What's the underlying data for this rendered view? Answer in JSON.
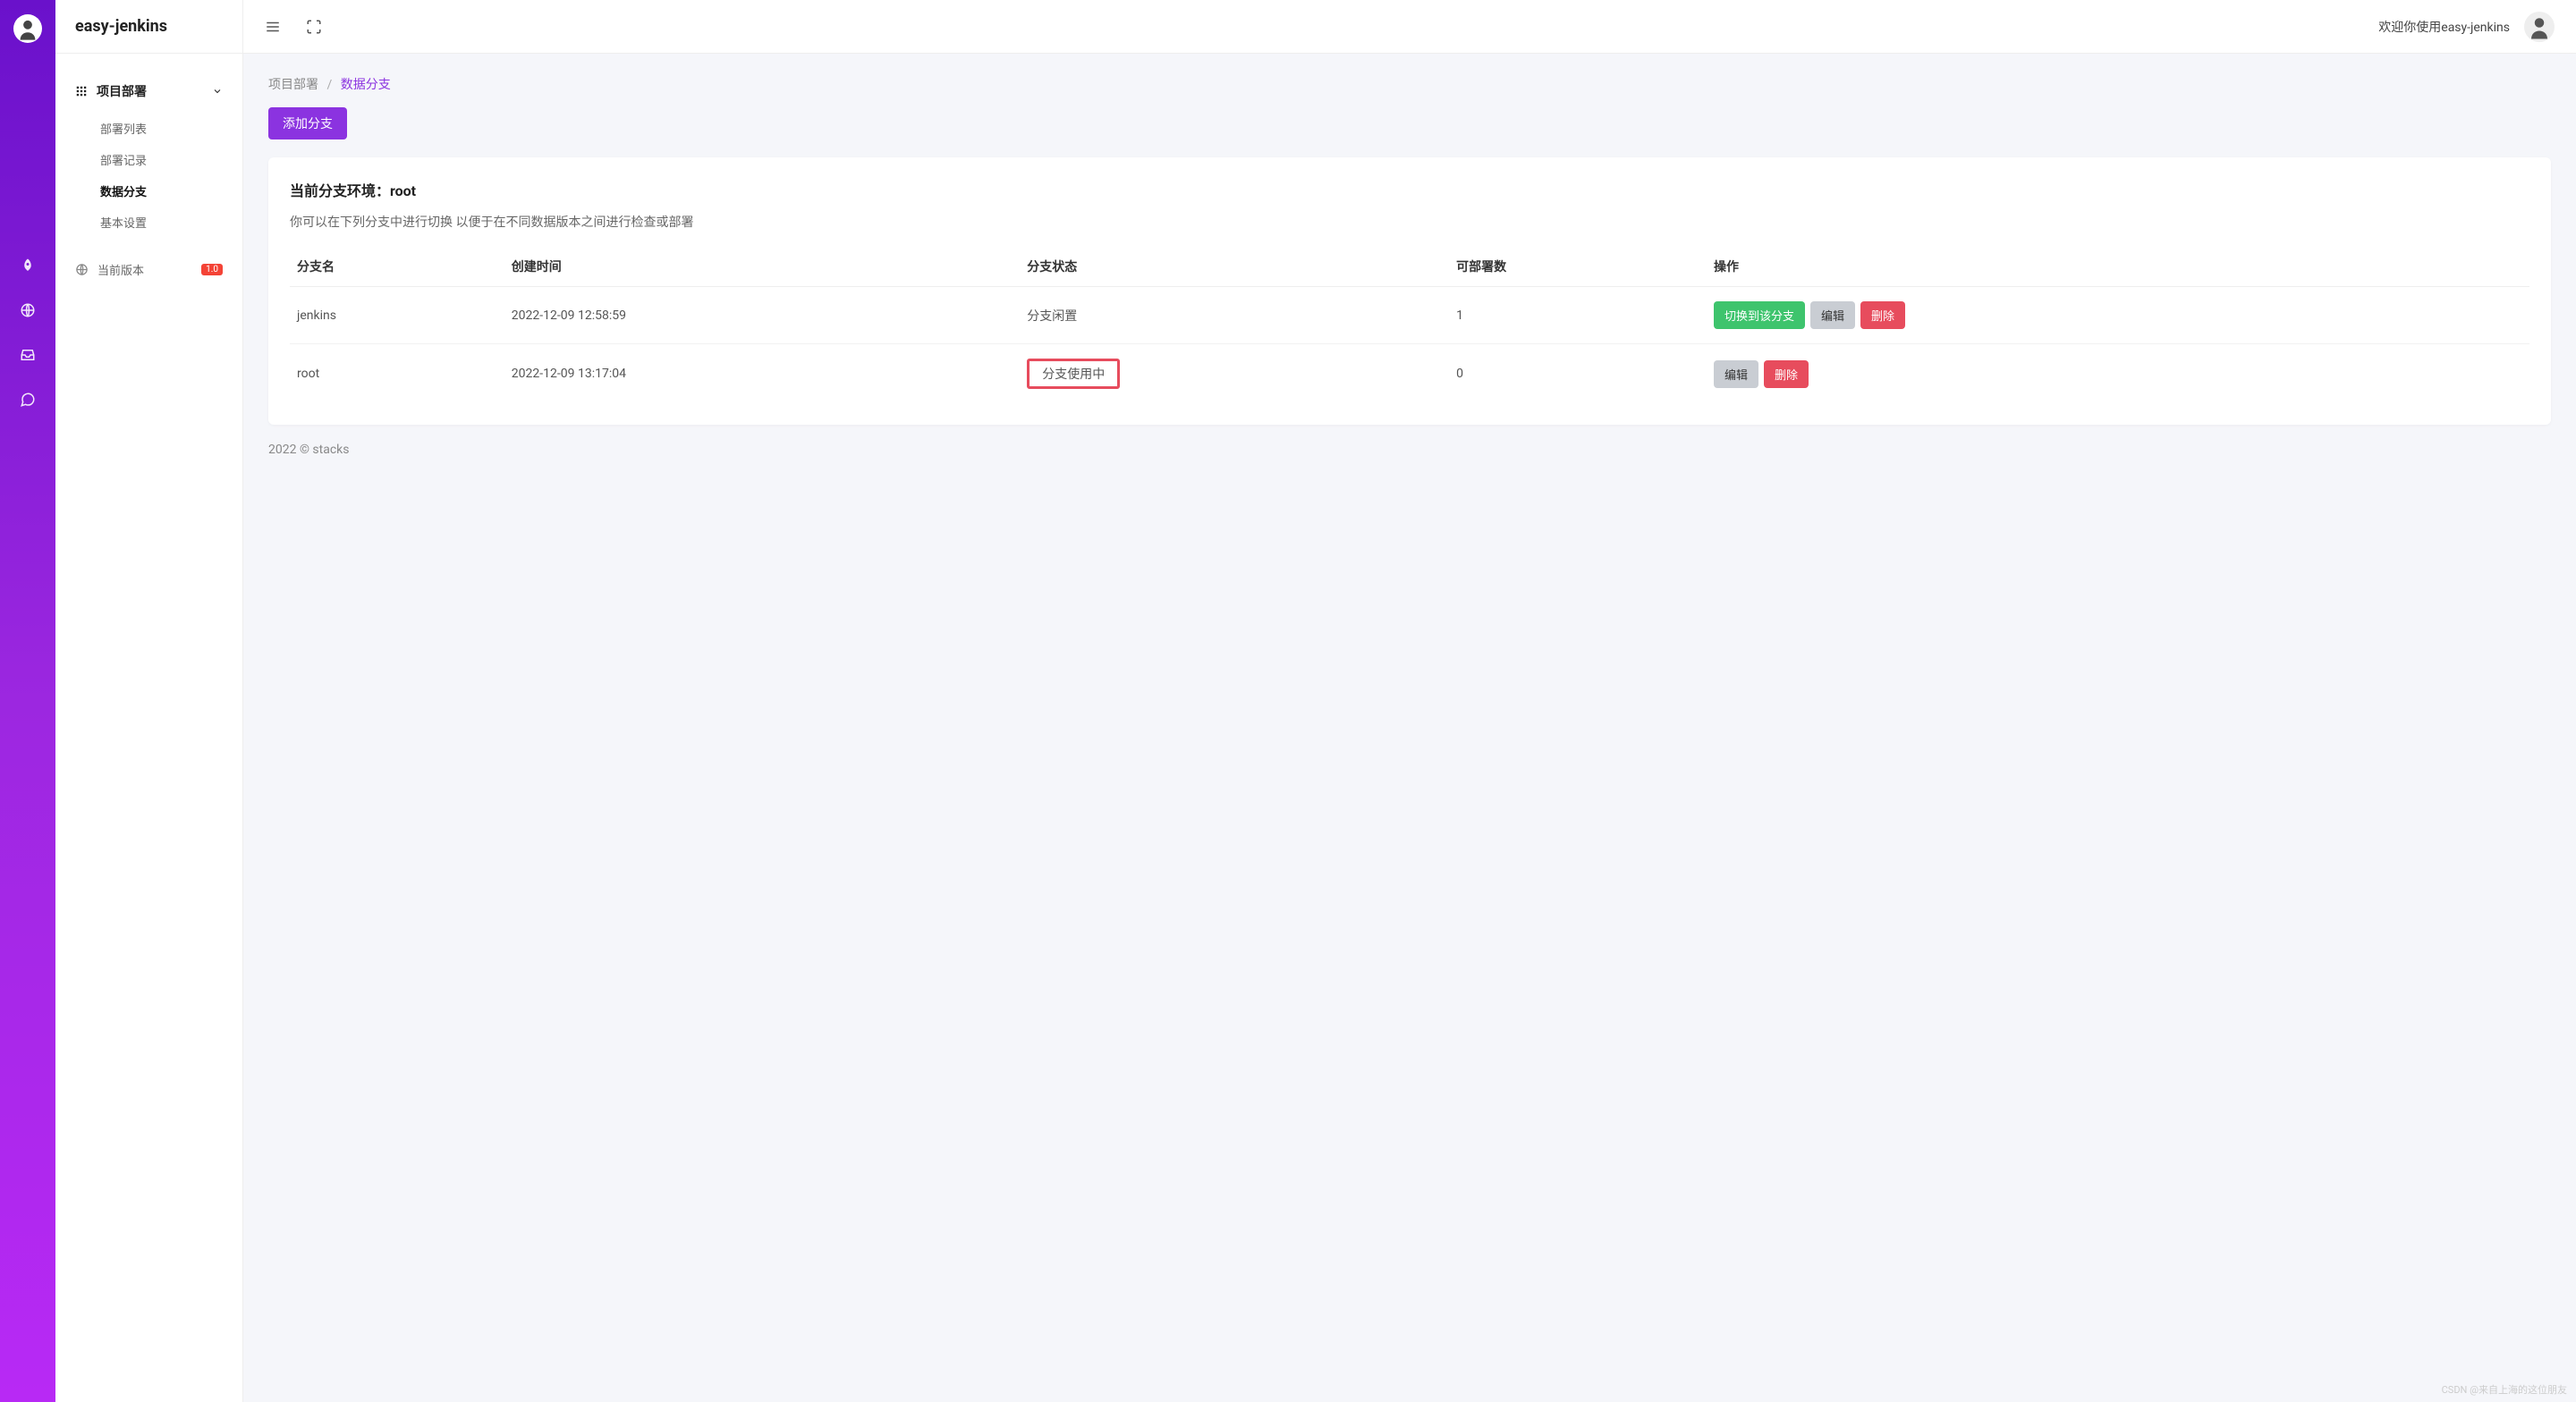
{
  "brand": "easy-jenkins",
  "header": {
    "welcome": "欢迎你使用easy-jenkins"
  },
  "sidebar": {
    "group_title": "项目部署",
    "items": [
      {
        "label": "部署列表"
      },
      {
        "label": "部署记录"
      },
      {
        "label": "数据分支"
      },
      {
        "label": "基本设置"
      }
    ],
    "version": {
      "label": "当前版本",
      "badge": "1.0"
    }
  },
  "breadcrumb": {
    "parent": "项目部署",
    "current": "数据分支"
  },
  "buttons": {
    "add_branch": "添加分支",
    "switch": "切换到该分支",
    "edit": "编辑",
    "delete": "删除"
  },
  "card": {
    "title": "当前分支环境：root",
    "subtitle": "你可以在下列分支中进行切换 以便于在不同数据版本之间进行检查或部署"
  },
  "table": {
    "headers": {
      "name": "分支名",
      "created": "创建时间",
      "status": "分支状态",
      "deployable": "可部署数",
      "ops": "操作"
    },
    "rows": [
      {
        "name": "jenkins",
        "created": "2022-12-09 12:58:59",
        "status": "分支闲置",
        "deployable": "1",
        "current": false
      },
      {
        "name": "root",
        "created": "2022-12-09 13:17:04",
        "status": "分支使用中",
        "deployable": "0",
        "current": true
      }
    ]
  },
  "footer": "2022 © stacks",
  "watermark": "CSDN @来自上海的这位朋友"
}
